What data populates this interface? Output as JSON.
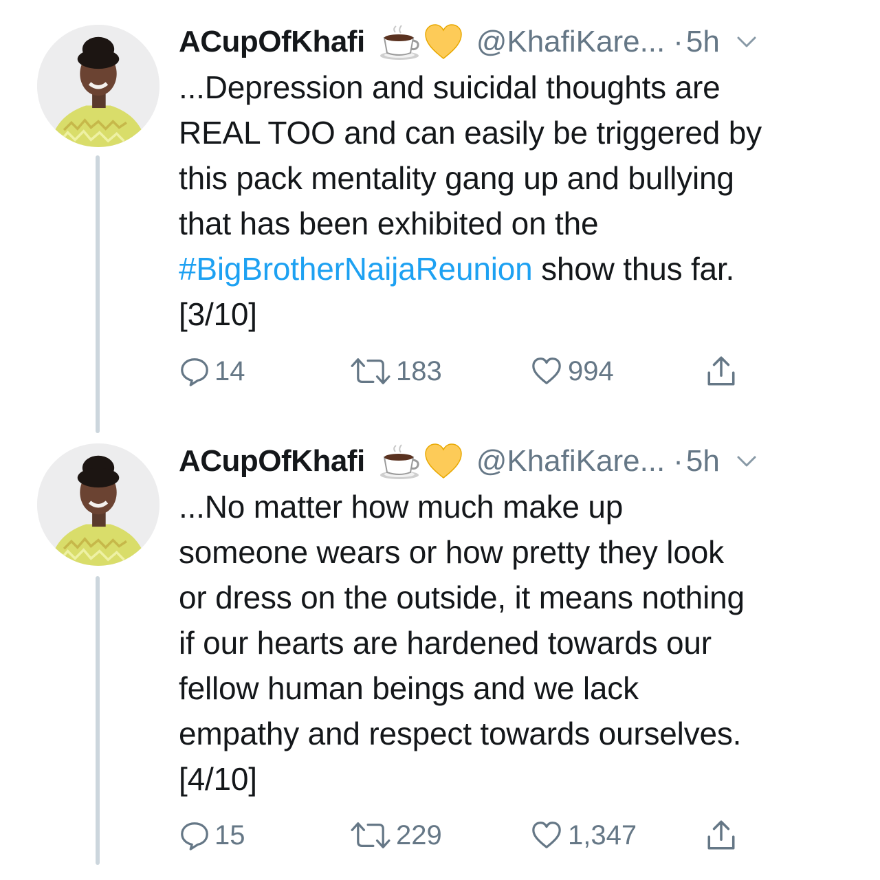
{
  "tweets": [
    {
      "display_name": "ACupOfKhafi",
      "emoji": [
        "coffee-cup",
        "yellow-heart"
      ],
      "handle": "@KhafiKare...",
      "separator": "·",
      "time": "5h",
      "text_before": "...Depression and suicidal thoughts are\nREAL TOO and can easily be triggered by\nthis pack mentality gang up and bullying\nthat has been exhibited on the\n",
      "hashtag": "#BigBrotherNaijaReunion",
      "text_after": " show thus far.\n[3/10]",
      "replies": "14",
      "retweets": "183",
      "likes": "994"
    },
    {
      "display_name": "ACupOfKhafi",
      "emoji": [
        "coffee-cup",
        "yellow-heart"
      ],
      "handle": "@KhafiKare...",
      "separator": "·",
      "time": "5h",
      "text": "...No matter how much make up\nsomeone wears or how pretty they look\nor dress on the outside, it means nothing\nif our hearts are hardened towards our\nfellow human beings and we lack\nempathy and respect towards ourselves.\n[4/10]",
      "replies": "15",
      "retweets": "229",
      "likes": "1,347"
    }
  ],
  "colors": {
    "text": "#14171a",
    "secondary": "#657786",
    "hashtag": "#1da1f2",
    "thread_line": "#ccd6dd",
    "heart_emoji": "#fdcb58"
  },
  "icons": {
    "reply": "speech-bubble-icon",
    "retweet": "retweet-icon",
    "like": "heart-outline-icon",
    "share": "share-upload-icon",
    "menu": "chevron-down-icon"
  }
}
